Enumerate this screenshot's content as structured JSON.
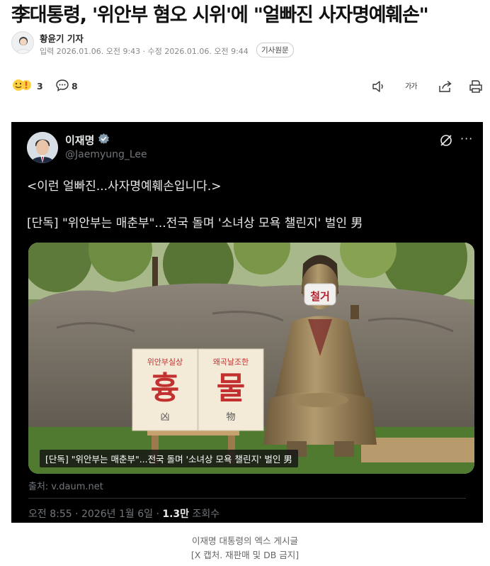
{
  "article": {
    "headline": "李대통령, '위안부 혐오 시위'에 \"얼빠진 사자명예훼손\"",
    "reporter": "황윤기 기자",
    "dates": "입력 2026.01.06. 오전 9:43 · 수정 2026.01.06. 오전 9:44",
    "original_button": "기사원문"
  },
  "actions": {
    "reaction_count": "3",
    "comment_count": "8",
    "font_size_label": "가가",
    "icons": [
      "reaction-emoji-icon",
      "comment-icon",
      "audio-icon",
      "font-size-icon",
      "share-icon",
      "print-icon"
    ]
  },
  "tweet": {
    "name": "이재명",
    "handle": "@Jaemyung_Lee",
    "text1": "<이런 얼빠진...사자명예훼손입니다.>",
    "text2": "[단독] \"위안부는 매춘부\"...전국 돌며 '소녀상 모욕 챌린지' 벌인 男",
    "image_caption": "[단독] \"위안부는 매춘부\"...전국 돌며 '소녀상 모욕 챌린지' 벌인 男",
    "sign_left": {
      "top": "위안부실상",
      "big": "흉",
      "hanja": "凶"
    },
    "sign_right": {
      "top": "왜곡날조한",
      "big": "물",
      "hanja": "物"
    },
    "mask_text": "철거",
    "source": "출처: v.daum.net",
    "time": "오전 8:55",
    "date": "2026년 1월 6일",
    "views": "1.3만",
    "views_label": "조회수",
    "colors": {
      "background": "#000000",
      "text": "#e7e9ea",
      "muted": "#71767b"
    }
  },
  "image_caption": {
    "line1": "이재명 대통령의 엑스 게시글",
    "line2": "[X 캡처. 재판매 및 DB 금지]"
  }
}
